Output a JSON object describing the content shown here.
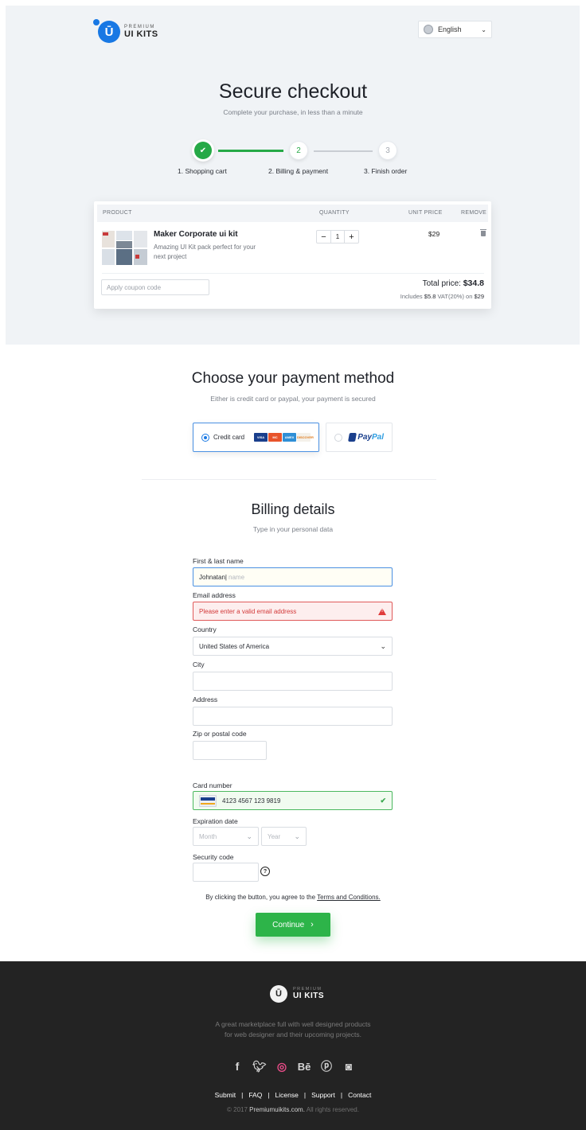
{
  "brand": {
    "small": "PREMIUM",
    "big": "UI KITS"
  },
  "language": {
    "selected": "English"
  },
  "checkout": {
    "title": "Secure checkout",
    "subtitle": "Complete your purchase, in less than a minute",
    "steps": [
      {
        "number": "✔",
        "label": "1. Shopping cart",
        "state": "done"
      },
      {
        "number": "2",
        "label": "2. Billing & payment",
        "state": "active"
      },
      {
        "number": "3",
        "label": "3. Finish order",
        "state": "todo"
      }
    ]
  },
  "cart": {
    "headers": {
      "product": "PRODUCT",
      "quantity": "QUANTITY",
      "unit_price": "UNIT PRICE",
      "remove": "REMOVE"
    },
    "item": {
      "name": "Maker Corporate ui kit",
      "description": "Amazing UI Kit pack perfect for your next project",
      "quantity": "1",
      "minus": "−",
      "plus": "+",
      "unit_price": "$29"
    },
    "coupon_placeholder": "Apply coupon code",
    "total_label": "Total price:",
    "total_value": "$34.8",
    "vat_prefix": "Includes",
    "vat_amount": "$5.8",
    "vat_middle": "VAT(20%) on",
    "vat_base": "$29"
  },
  "payment": {
    "title": "Choose your payment method",
    "subtitle": "Either is credit card or paypal, your payment is secured",
    "credit_label": "Credit card",
    "card_brands": [
      "VISA",
      "MC",
      "AMEX",
      "DISCOVER"
    ],
    "paypal_label": "Pay",
    "paypal_label_2": "Pal"
  },
  "billing": {
    "title": "Billing details",
    "subtitle": "Type in your personal data",
    "name_label": "First & last name",
    "name_value": "Johnatan|",
    "name_placeholder": "name",
    "email_label": "Email address",
    "email_error": "Please enter a valid email address",
    "country_label": "Country",
    "country_value": "United States of America",
    "city_label": "City",
    "address_label": "Address",
    "zip_label": "Zip or postal code",
    "card_label": "Card number",
    "card_value": "4123 4567 123 9819",
    "expiration_label": "Expiration date",
    "month_placeholder": "Month",
    "year_placeholder": "Year",
    "security_label": "Security code",
    "help": "?",
    "terms_prefix": "By clicking the button, you agree to the",
    "terms_link": "Terms and Conditions.",
    "continue": "Continue"
  },
  "footer": {
    "desc_line1": "A great marketplace full with well designed products",
    "desc_line2": "for web designer and their upcoming projects.",
    "social_icons": [
      "facebook-icon",
      "twitter-icon",
      "dribbble-icon",
      "behance-icon",
      "pinterest-icon",
      "instagram-icon"
    ],
    "links": [
      "Submit",
      "FAQ",
      "License",
      "Support",
      "Contact"
    ],
    "copy_prefix": "© 2017",
    "copy_site": "Premiumuikits.com.",
    "copy_suffix": "All rights reserved."
  },
  "colors": {
    "accent_blue": "#1878e4",
    "success_green": "#2db449",
    "error_red": "#e05a5a",
    "footer_bg": "#232323"
  }
}
